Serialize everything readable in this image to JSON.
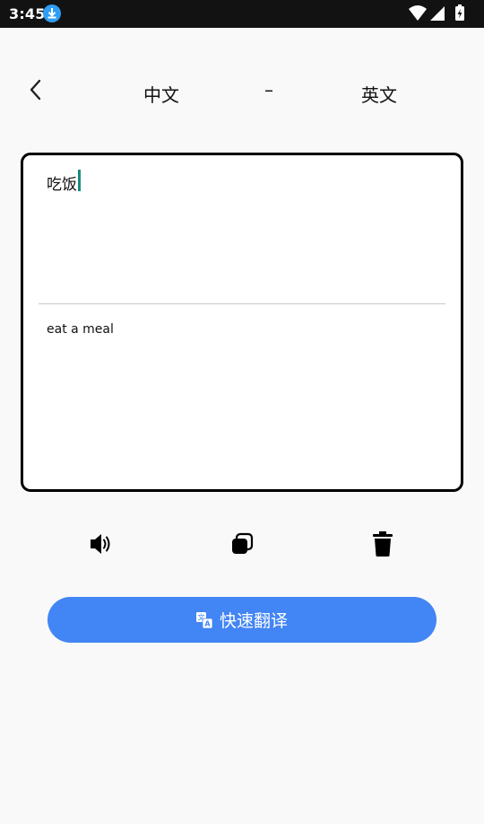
{
  "status_bar": {
    "time": "3:45",
    "icons": [
      "download-icon",
      "wifi-icon",
      "signal-icon",
      "battery-charging-icon"
    ]
  },
  "header": {
    "back_icon": "chevron-left-icon",
    "source_language": "中文",
    "separator": "–",
    "target_language": "英文"
  },
  "translator": {
    "input_text": "吃饭",
    "output_text": "eat a meal"
  },
  "actions": {
    "icons": [
      "speaker-icon",
      "copy-icon",
      "trash-icon"
    ]
  },
  "translate_button": {
    "icon": "translate-icon",
    "label": "快速翻译"
  },
  "colors": {
    "accent": "#4285f4",
    "caret": "#1a8a7e",
    "status_bar": "#121212",
    "background": "#f9f9f9"
  }
}
